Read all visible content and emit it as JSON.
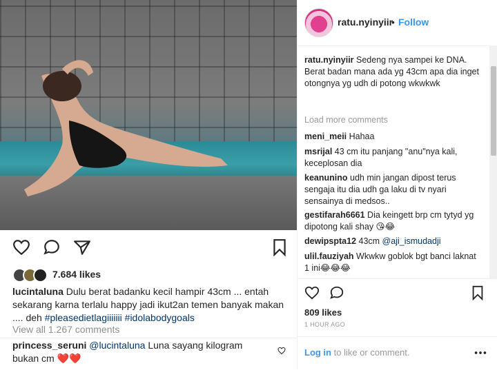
{
  "left_post": {
    "likes": "7.684 likes",
    "caption": {
      "user": "lucintaluna",
      "text": " Dulu berat badanku kecil hampir 43cm ... entah sekarang karna terlalu happy jadi ikut2an temen banyak makan .... deh ",
      "hashtags": "#pleasedietlagiiiiiii #idolabodygoals"
    },
    "view_all": "View all 1.267 comments",
    "reply": {
      "user": "princess_seruni",
      "mention": "@lucintaluna",
      "text": " Luna sayang kilogram bukan cm ",
      "emoji": "❤️❤️"
    }
  },
  "right_panel": {
    "header": {
      "username": "ratu.nyinyiir",
      "dot": "•",
      "follow": "Follow"
    },
    "caption": {
      "user": "ratu.nyinyiir",
      "text": " Sedeng nya sampei ke DNA. Berat badan mana ada yg 43cm apa dia inget otongnya yg udh di potong wkwkwk"
    },
    "load_more": "Load more comments",
    "comments": [
      {
        "user": "meni_meii",
        "text": " Hahaa"
      },
      {
        "user": "msrijal",
        "text": " 43 cm itu panjang \"anu\"nya kali, keceplosan dia"
      },
      {
        "user": "keanunino",
        "text": " udh min jangan dipost terus sengaja itu dia udh ga laku di tv nyari sensainya di medsos.."
      },
      {
        "user": "gestifarah6661",
        "text": " Dia keingett brp cm tytyd yg dipotong kali shay 😘😂"
      },
      {
        "user": "dewipspta12",
        "text": " 43cm ",
        "mention": "@aji_ismudadji"
      },
      {
        "user": "ulil.fauziyah",
        "text": " Wkwkw goblok bgt banci laknat 1 ini😂😂😂"
      }
    ],
    "likes": "809 likes",
    "time": "1 HOUR AGO",
    "login": {
      "link": "Log in",
      "rest": " to like or comment."
    }
  }
}
